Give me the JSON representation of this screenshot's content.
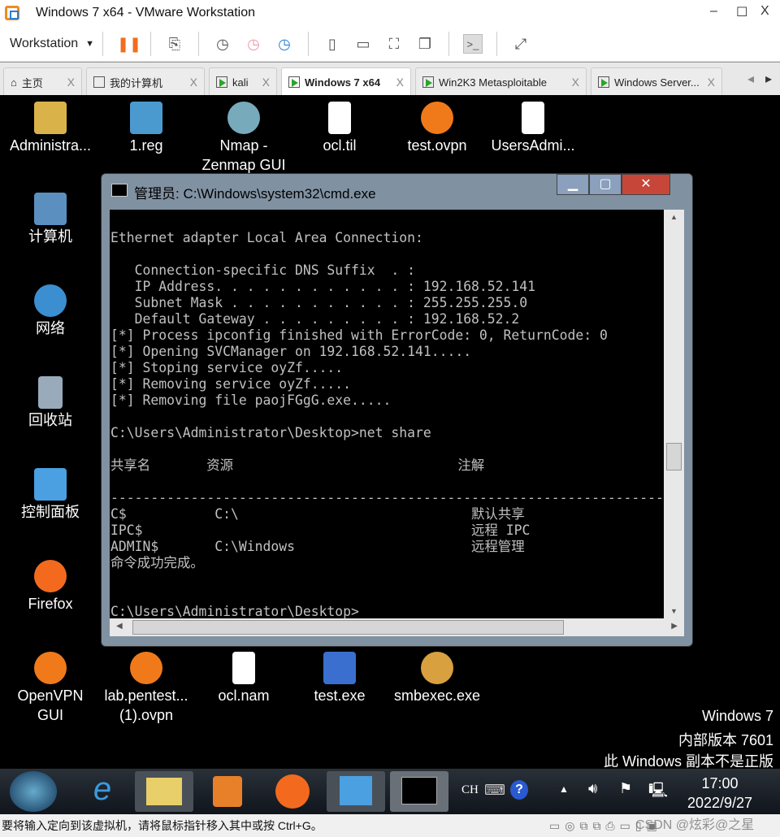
{
  "window": {
    "title": "Windows 7 x64 - VMware Workstation",
    "min": "–",
    "max": "☐",
    "close": "X"
  },
  "toolbar": {
    "workstation": "Workstation",
    "dropdown": "▼"
  },
  "tabs": [
    {
      "label": "主页"
    },
    {
      "label": "我的计算机"
    },
    {
      "label": "kali"
    },
    {
      "label": "Windows 7 x64"
    },
    {
      "label": "Win2K3 Metasploitable"
    },
    {
      "label": "Windows Server..."
    }
  ],
  "desktop_icons": [
    {
      "label": "Administra..."
    },
    {
      "label": "1.reg"
    },
    {
      "label": "Nmap -\nZenmap GUI"
    },
    {
      "label": "ocl.til"
    },
    {
      "label": "test.ovpn"
    },
    {
      "label": "UsersAdmi..."
    },
    {
      "label": "计算机"
    },
    {
      "label": "网络"
    },
    {
      "label": "回收站"
    },
    {
      "label": "控制面板"
    },
    {
      "label": "Firefox"
    },
    {
      "label": "OpenVPN\nGUI"
    },
    {
      "label": "lab.pentest...\n(1).ovpn"
    },
    {
      "label": "ocl.nam"
    },
    {
      "label": "test.exe"
    },
    {
      "label": "smbexec.exe"
    }
  ],
  "cmd": {
    "title": "管理员: C:\\Windows\\system32\\cmd.exe",
    "lines": [
      "",
      "Ethernet adapter Local Area Connection:",
      "",
      "   Connection-specific DNS Suffix  . :",
      "   IP Address. . . . . . . . . . . . : 192.168.52.141",
      "   Subnet Mask . . . . . . . . . . . : 255.255.255.0",
      "   Default Gateway . . . . . . . . . : 192.168.52.2",
      "[*] Process ipconfig finished with ErrorCode: 0, ReturnCode: 0",
      "[*] Opening SVCManager on 192.168.52.141.....",
      "[*] Stoping service oyZf.....",
      "[*] Removing service oyZf.....",
      "[*] Removing file paojFGgG.exe.....",
      "",
      "C:\\Users\\Administrator\\Desktop>net share",
      "",
      "共享名       资源                            注解",
      "",
      "-------------------------------------------------------------------------------",
      "C$           C:\\                             默认共享",
      "IPC$                                         远程 IPC",
      "ADMIN$       C:\\Windows                      远程管理",
      "命令成功完成。",
      "",
      "",
      "C:\\Users\\Administrator\\Desktop>_"
    ]
  },
  "watermark": [
    "Windows 7",
    "内部版本 7601",
    "此 Windows 副本不是正版"
  ],
  "tray": {
    "lang": "CH",
    "time": "17:00",
    "date": "2022/9/27"
  },
  "status": "要将输入定向到该虚拟机，请将鼠标指针移入其中或按 Ctrl+G。",
  "overlay_watermark": "CSDN @炫彩@之星"
}
